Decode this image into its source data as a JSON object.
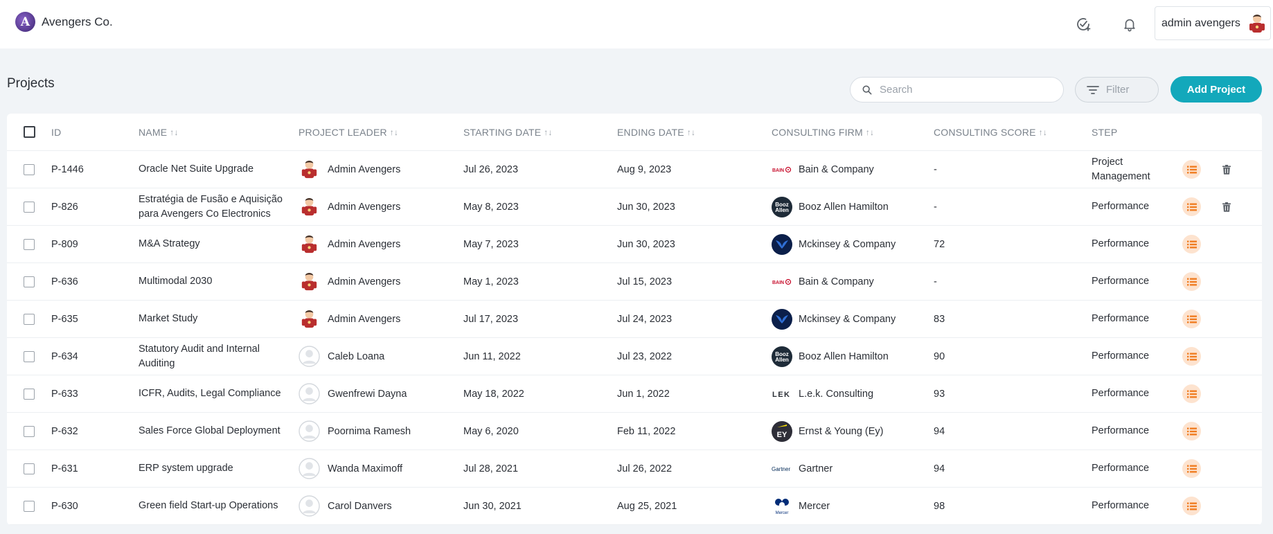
{
  "header": {
    "brand": "Avengers Co.",
    "user_name": "admin avengers",
    "icons": [
      "check-add-icon",
      "bell-icon"
    ]
  },
  "toolbar": {
    "title": "Projects",
    "search_placeholder": "Search",
    "filter_label": "Filter",
    "add_label": "Add Project"
  },
  "colors": {
    "accent": "#13a8bb",
    "step_icon": "#f07d22",
    "step_icon_bg": "#fde3cf"
  },
  "table": {
    "columns": [
      {
        "key": "id",
        "label": "ID",
        "sortable": false
      },
      {
        "key": "name",
        "label": "NAME",
        "sortable": true
      },
      {
        "key": "leader",
        "label": "PROJECT LEADER",
        "sortable": true
      },
      {
        "key": "start",
        "label": "STARTING DATE",
        "sortable": true
      },
      {
        "key": "end",
        "label": "ENDING DATE",
        "sortable": true
      },
      {
        "key": "firm",
        "label": "CONSULTING FIRM",
        "sortable": true
      },
      {
        "key": "score",
        "label": "CONSULTING SCORE",
        "sortable": true
      },
      {
        "key": "step",
        "label": "STEP",
        "sortable": false
      }
    ],
    "rows": [
      {
        "id": "P-1446",
        "name": [
          "Oracle Net Suite Upgrade"
        ],
        "leader": "Admin Avengers",
        "leader_avatar": "hero",
        "start": "Jul 26, 2023",
        "end": "Aug 9, 2023",
        "firm": "Bain & Company",
        "firm_logo": "bain",
        "score": "-",
        "step": [
          "Project",
          "Management"
        ],
        "deletable": true
      },
      {
        "id": "P-826",
        "name": [
          "Estratégia de Fusão e Aquisição",
          "para Avengers Co Electronics"
        ],
        "leader": "Admin Avengers",
        "leader_avatar": "hero",
        "start": "May 8, 2023",
        "end": "Jun 30, 2023",
        "firm": "Booz Allen Hamilton",
        "firm_logo": "booz",
        "score": "-",
        "step": [
          "Performance"
        ],
        "deletable": true
      },
      {
        "id": "P-809",
        "name": [
          "M&A Strategy"
        ],
        "leader": "Admin Avengers",
        "leader_avatar": "hero",
        "start": "May 7, 2023",
        "end": "Jun 30, 2023",
        "firm": "Mckinsey & Company",
        "firm_logo": "mckinsey",
        "score": "72",
        "step": [
          "Performance"
        ],
        "deletable": false
      },
      {
        "id": "P-636",
        "name": [
          "Multimodal 2030"
        ],
        "leader": "Admin Avengers",
        "leader_avatar": "hero",
        "start": "May 1, 2023",
        "end": "Jul 15, 2023",
        "firm": "Bain & Company",
        "firm_logo": "bain",
        "score": "-",
        "step": [
          "Performance"
        ],
        "deletable": false
      },
      {
        "id": "P-635",
        "name": [
          "Market Study"
        ],
        "leader": "Admin Avengers",
        "leader_avatar": "hero",
        "start": "Jul 17, 2023",
        "end": "Jul 24, 2023",
        "firm": "Mckinsey & Company",
        "firm_logo": "mckinsey",
        "score": "83",
        "step": [
          "Performance"
        ],
        "deletable": false
      },
      {
        "id": "P-634",
        "name": [
          "Statutory Audit and Internal",
          "Auditing"
        ],
        "leader": "Caleb Loana",
        "leader_avatar": "default",
        "start": "Jun 11, 2022",
        "end": "Jul 23, 2022",
        "firm": "Booz Allen Hamilton",
        "firm_logo": "booz",
        "score": "90",
        "step": [
          "Performance"
        ],
        "deletable": false
      },
      {
        "id": "P-633",
        "name": [
          "ICFR, Audits, Legal Compliance"
        ],
        "leader": "Gwenfrewi Dayna",
        "leader_avatar": "default",
        "start": "May 18, 2022",
        "end": "Jun 1, 2022",
        "firm": "L.e.k. Consulting",
        "firm_logo": "lek",
        "score": "93",
        "step": [
          "Performance"
        ],
        "deletable": false
      },
      {
        "id": "P-632",
        "name": [
          "Sales Force Global Deployment"
        ],
        "leader": "Poornima Ramesh",
        "leader_avatar": "default",
        "start": "May 6, 2020",
        "end": "Feb 11, 2022",
        "firm": "Ernst & Young (Ey)",
        "firm_logo": "ey",
        "score": "94",
        "step": [
          "Performance"
        ],
        "deletable": false
      },
      {
        "id": "P-631",
        "name": [
          "ERP system upgrade"
        ],
        "leader": "Wanda Maximoff",
        "leader_avatar": "default",
        "start": "Jul 28, 2021",
        "end": "Jul 26, 2022",
        "firm": "Gartner",
        "firm_logo": "gartner",
        "score": "94",
        "step": [
          "Performance"
        ],
        "deletable": false
      },
      {
        "id": "P-630",
        "name": [
          "Green field Start-up Operations"
        ],
        "leader": "Carol Danvers",
        "leader_avatar": "default",
        "start": "Jun 30, 2021",
        "end": "Aug 25, 2021",
        "firm": "Mercer",
        "firm_logo": "mercer",
        "score": "98",
        "step": [
          "Performance"
        ],
        "deletable": false
      }
    ]
  }
}
